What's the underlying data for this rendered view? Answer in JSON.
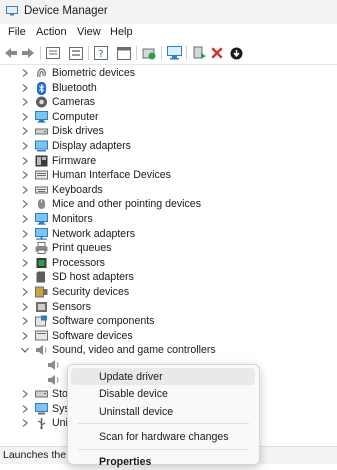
{
  "window": {
    "title": "Device Manager"
  },
  "menu": [
    "File",
    "Action",
    "View",
    "Help"
  ],
  "toolbar": [
    {
      "name": "back-arrow-icon"
    },
    {
      "name": "forward-arrow-icon"
    },
    {
      "name": "properties-icon"
    },
    {
      "name": "device-list-icon"
    },
    {
      "name": "help-icon"
    },
    {
      "name": "window-icon"
    },
    {
      "name": "update-driver-icon"
    },
    {
      "name": "scan-hardware-icon"
    },
    {
      "name": "enable-device-icon"
    },
    {
      "name": "uninstall-device-icon"
    },
    {
      "name": "download-icon"
    }
  ],
  "tree": {
    "items": [
      {
        "label": "Biometric devices",
        "icon": "fingerprint-icon",
        "state": "collapsed"
      },
      {
        "label": "Bluetooth",
        "icon": "bluetooth-icon",
        "state": "collapsed"
      },
      {
        "label": "Cameras",
        "icon": "camera-icon",
        "state": "collapsed"
      },
      {
        "label": "Computer",
        "icon": "computer-icon",
        "state": "collapsed"
      },
      {
        "label": "Disk drives",
        "icon": "disk-drive-icon",
        "state": "collapsed"
      },
      {
        "label": "Display adapters",
        "icon": "display-adapter-icon",
        "state": "collapsed"
      },
      {
        "label": "Firmware",
        "icon": "firmware-icon",
        "state": "collapsed"
      },
      {
        "label": "Human Interface Devices",
        "icon": "hid-icon",
        "state": "collapsed"
      },
      {
        "label": "Keyboards",
        "icon": "keyboard-icon",
        "state": "collapsed"
      },
      {
        "label": "Mice and other pointing devices",
        "icon": "mouse-icon",
        "state": "collapsed"
      },
      {
        "label": "Monitors",
        "icon": "monitor-icon",
        "state": "collapsed"
      },
      {
        "label": "Network adapters",
        "icon": "network-adapter-icon",
        "state": "collapsed"
      },
      {
        "label": "Print queues",
        "icon": "printer-icon",
        "state": "collapsed"
      },
      {
        "label": "Processors",
        "icon": "processor-icon",
        "state": "collapsed"
      },
      {
        "label": "SD host adapters",
        "icon": "sd-card-icon",
        "state": "collapsed"
      },
      {
        "label": "Security devices",
        "icon": "security-device-icon",
        "state": "collapsed"
      },
      {
        "label": "Sensors",
        "icon": "sensor-icon",
        "state": "collapsed"
      },
      {
        "label": "Software components",
        "icon": "software-component-icon",
        "state": "collapsed"
      },
      {
        "label": "Software devices",
        "icon": "software-device-icon",
        "state": "collapsed"
      },
      {
        "label": "Sound, video and game controllers",
        "icon": "speaker-icon",
        "state": "expanded"
      },
      {
        "label": "",
        "icon": "speaker-icon",
        "state": "child"
      },
      {
        "label": "",
        "icon": "speaker-icon",
        "state": "child"
      },
      {
        "label": "Stor",
        "icon": "storage-controller-icon",
        "state": "collapsed"
      },
      {
        "label": "Syst",
        "icon": "system-device-icon",
        "state": "collapsed"
      },
      {
        "label": "Univ",
        "icon": "usb-icon",
        "state": "collapsed"
      }
    ]
  },
  "context_menu": {
    "items": [
      {
        "label": "Update driver",
        "highlighted": true
      },
      {
        "label": "Disable device"
      },
      {
        "label": "Uninstall device"
      },
      {
        "separator": true
      },
      {
        "label": "Scan for hardware changes"
      },
      {
        "separator": true
      },
      {
        "label": "Properties",
        "bold": true
      }
    ]
  },
  "status": {
    "text": "Launches the U"
  },
  "colors": {
    "accent": "#0078d4",
    "icon_gray": "#5d5d5d",
    "delete_red": "#d13438",
    "highlight": "#e9e9e9"
  }
}
